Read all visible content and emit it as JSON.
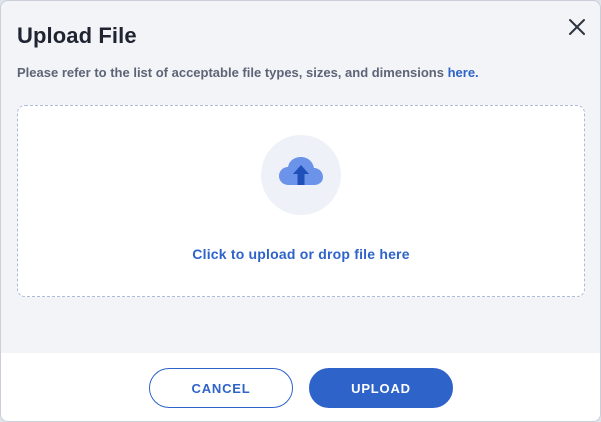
{
  "dialog": {
    "title": "Upload File",
    "info_text": "Please refer to the list of acceptable file types, sizes, and dimensions ",
    "info_link": "here.",
    "dropzone_label": "Click to upload or drop file here",
    "icons": {
      "close": "close-icon",
      "upload": "cloud-upload-icon"
    }
  },
  "footer": {
    "cancel_label": "CANCEL",
    "upload_label": "UPLOAD"
  },
  "colors": {
    "accent": "#2e63c9",
    "background": "#f2f4f8",
    "cloud": "#6b93ea",
    "title": "#1f2430",
    "muted_text": "#5d6475"
  }
}
